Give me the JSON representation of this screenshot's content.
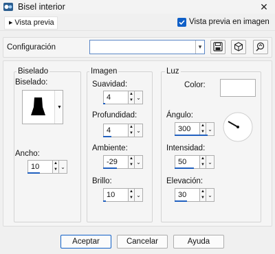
{
  "window": {
    "title": "Bisel interior",
    "close_glyph": "✕"
  },
  "preview": {
    "toggle_label": "Vista previa",
    "checkbox_label": "Vista previa en imagen",
    "checked": true
  },
  "config": {
    "label": "Configuración",
    "value": "",
    "buttons": [
      "save-icon",
      "cube-icon",
      "reset-icon"
    ]
  },
  "bevel": {
    "group": "Biselado",
    "label": "Biselado:",
    "width_label": "Ancho:",
    "width_value": "10"
  },
  "image": {
    "group": "Imagen",
    "softness_label": "Suavidad:",
    "softness_value": "4",
    "depth_label": "Profundidad:",
    "depth_value": "4",
    "ambience_label": "Ambiente:",
    "ambience_value": "-29",
    "shininess_label": "Brillo:",
    "shininess_value": "10"
  },
  "light": {
    "group": "Luz",
    "color_label": "Color:",
    "color_value": "#ffffff",
    "angle_label": "Ángulo:",
    "angle_value": "300",
    "intensity_label": "Intensidad:",
    "intensity_value": "50",
    "elevation_label": "Elevación:",
    "elevation_value": "30"
  },
  "footer": {
    "accept": "Aceptar",
    "cancel": "Cancelar",
    "help": "Ayuda"
  },
  "colors": {
    "accent": "#0f5fc7",
    "slider_fill": "#1f5fbf"
  }
}
